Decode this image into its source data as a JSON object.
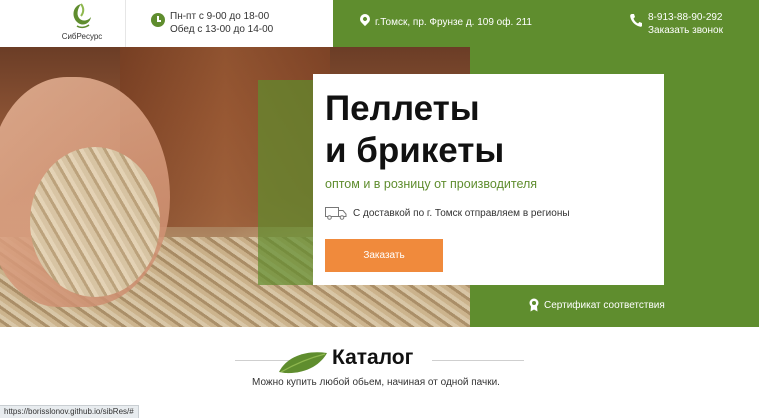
{
  "header": {
    "logo_text": "СибРесурс",
    "hours_line1": "Пн-пт с 9-00 до 18-00",
    "hours_line2": "Обед с 13-00 до 14-00",
    "address": "г.Томск, пр. Фрунзе д. 109 оф. 211",
    "phone": "8-913-88-90-292",
    "callback_label": "Заказать звонок"
  },
  "hero": {
    "title_line1": "Пеллеты",
    "title_line2": "и брикеты",
    "subtitle": "оптом и в розницу от производителя",
    "delivery_text": "С доставкой по г. Томск отправляем в регионы",
    "order_button": "Заказать",
    "certificate_link": "Сертификат соответствия"
  },
  "catalog": {
    "title": "Каталог",
    "description": "Можно купить любой обьем, начиная от одной пачки."
  },
  "status_bar": {
    "url": "https://borisslonov.github.io/sibRes/#"
  },
  "icons": {
    "clock": "clock-icon",
    "pin": "map-pin-icon",
    "phone": "phone-icon",
    "truck": "truck-icon",
    "certificate": "certificate-icon",
    "leaf": "leaf-icon"
  },
  "colors": {
    "brand_green": "#5f8d2e",
    "accent_orange": "#f08a3c"
  }
}
